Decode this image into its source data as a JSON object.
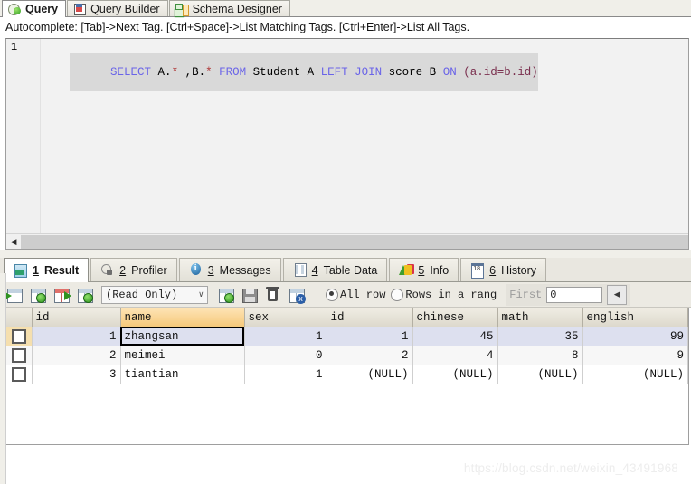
{
  "top_tabs": [
    {
      "label": "Query",
      "icon": "query-globe-icon",
      "active": true
    },
    {
      "label": "Query Builder",
      "icon": "query-builder-icon",
      "active": false
    },
    {
      "label": "Schema Designer",
      "icon": "schema-designer-icon",
      "active": false
    }
  ],
  "hint_bar": {
    "text": "Autocomplete: [Tab]->Next Tag. [Ctrl+Space]->List Matching Tags. [Ctrl+Enter]->List All Tags."
  },
  "editor": {
    "line_number": "1",
    "sql_tokens": [
      {
        "t": "SELECT",
        "c": "kw"
      },
      {
        "t": " A.",
        "c": "pln"
      },
      {
        "t": "*",
        "c": "star"
      },
      {
        "t": " ,B.",
        "c": "pln"
      },
      {
        "t": "*",
        "c": "star"
      },
      {
        "t": " ",
        "c": "pln"
      },
      {
        "t": "FROM",
        "c": "kw"
      },
      {
        "t": " Student A ",
        "c": "pln"
      },
      {
        "t": "LEFT JOIN",
        "c": "kw"
      },
      {
        "t": " score B ",
        "c": "pln"
      },
      {
        "t": "ON",
        "c": "kw"
      },
      {
        "t": " ",
        "c": "pln"
      },
      {
        "t": "(a.id=b.id)",
        "c": "paren"
      }
    ],
    "full_sql": "SELECT A.* ,B.* FROM Student A LEFT JOIN score B ON (a.id=b.id)",
    "scroll_left_arrow": "◀"
  },
  "result_tabs": [
    {
      "num": "1",
      "label": "Result",
      "icon": "result-grid-icon",
      "active": true
    },
    {
      "num": "2",
      "label": "Profiler",
      "icon": "profiler-icon",
      "active": false
    },
    {
      "num": "3",
      "label": "Messages",
      "icon": "info-bubble-icon",
      "active": false
    },
    {
      "num": "4",
      "label": "Table Data",
      "icon": "table-data-icon",
      "active": false
    },
    {
      "num": "5",
      "label": "Info",
      "icon": "chart-info-icon",
      "active": false
    },
    {
      "num": "6",
      "label": "History",
      "icon": "calendar-icon",
      "active": false
    }
  ],
  "grid_toolbar": {
    "icons_left": [
      {
        "name": "insert-record-icon"
      },
      {
        "name": "duplicate-record-icon"
      },
      {
        "name": "edit-record-icon"
      },
      {
        "name": "add-record-icon"
      }
    ],
    "mode_select": {
      "value": "(Read Only)",
      "chevron": "∨"
    },
    "icons_right": [
      {
        "name": "post-record-icon"
      },
      {
        "name": "save-record-icon"
      },
      {
        "name": "delete-record-icon"
      },
      {
        "name": "cancel-record-icon"
      }
    ],
    "radio_all_rows": {
      "label": "All row",
      "selected": true
    },
    "radio_range": {
      "label": "Rows in a rang",
      "selected": false
    },
    "first_label": "First",
    "first_value": "0",
    "spinner_left": "◀"
  },
  "result_grid": {
    "columns": [
      {
        "label": "id",
        "align": "num",
        "highlight": false
      },
      {
        "label": "name",
        "align": "txt",
        "highlight": true
      },
      {
        "label": "sex",
        "align": "num",
        "highlight": false
      },
      {
        "label": "id",
        "align": "num",
        "highlight": false
      },
      {
        "label": "chinese",
        "align": "num",
        "highlight": false
      },
      {
        "label": "math",
        "align": "num",
        "highlight": false
      },
      {
        "label": "english",
        "align": "num",
        "highlight": false
      }
    ],
    "rows": [
      {
        "selected": true,
        "cells": [
          "1",
          "zhangsan",
          "1",
          "1",
          "45",
          "35",
          "99"
        ]
      },
      {
        "selected": false,
        "cells": [
          "2",
          "meimei",
          "0",
          "2",
          "4",
          "8",
          "9"
        ]
      },
      {
        "selected": false,
        "cells": [
          "3",
          "tiantian",
          "1",
          "(NULL)",
          "(NULL)",
          "(NULL)",
          "(NULL)"
        ]
      }
    ]
  },
  "watermark": {
    "text": "https://blog.csdn.net/weixin_43491968"
  }
}
